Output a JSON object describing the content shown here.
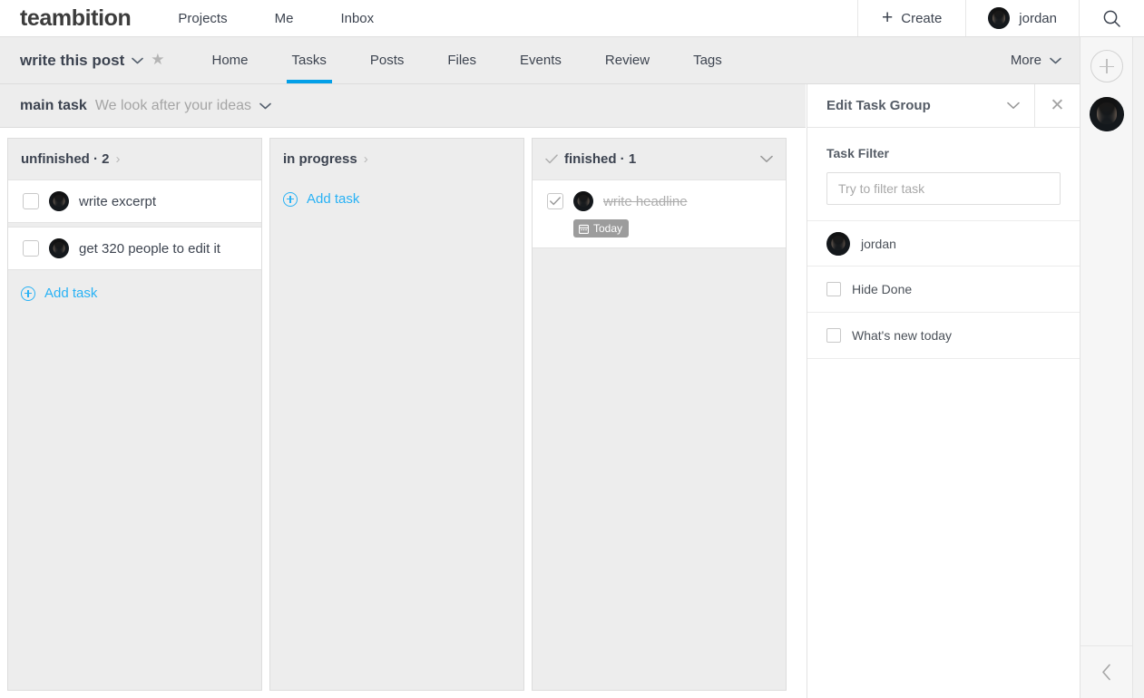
{
  "topbar": {
    "brand": "teambition",
    "nav": [
      {
        "label": "Projects"
      },
      {
        "label": "Me"
      },
      {
        "label": "Inbox"
      }
    ],
    "create_label": "Create",
    "create_icon": "plus-icon",
    "user_name": "jordan",
    "search_icon": "search-icon"
  },
  "projectbar": {
    "project_name": "write this post",
    "project_chevron_icon": "chevron-down-icon",
    "star_icon": "star-icon",
    "tabs": [
      {
        "label": "Home",
        "active": false
      },
      {
        "label": "Tasks",
        "active": true
      },
      {
        "label": "Posts",
        "active": false
      },
      {
        "label": "Files",
        "active": false
      },
      {
        "label": "Events",
        "active": false
      },
      {
        "label": "Review",
        "active": false
      },
      {
        "label": "Tags",
        "active": false
      }
    ],
    "more_label": "More",
    "more_icon": "chevron-down-icon",
    "accent_color": "#03a0e8"
  },
  "subheader": {
    "title": "main task",
    "description": "We look after your ideas",
    "chevron_icon": "chevron-down-icon"
  },
  "board": {
    "columns": [
      {
        "title": "unfinished · 2",
        "header_icon": "chevron-right-icon",
        "collapse_icon": null,
        "has_check": false,
        "tasks": [
          {
            "text": "write excerpt",
            "done": false,
            "badge": null
          },
          {
            "text": "get 320 people to edit it",
            "done": false,
            "badge": null
          }
        ],
        "add_label": "Add task",
        "add_icon": "plus-circle-icon",
        "show_add": true
      },
      {
        "title": "in progress",
        "header_icon": "chevron-right-icon",
        "collapse_icon": null,
        "has_check": false,
        "tasks": [],
        "add_label": "Add task",
        "add_icon": "plus-circle-icon",
        "show_add": true
      },
      {
        "title": "finished · 1",
        "header_icon": null,
        "collapse_icon": "chevron-down-icon",
        "has_check": true,
        "check_icon": "check-icon",
        "tasks": [
          {
            "text": "write headline",
            "done": true,
            "badge": "Today",
            "badge_icon": "calendar-icon"
          }
        ],
        "add_label": "Add task",
        "add_icon": "plus-circle-icon",
        "show_add": false
      }
    ]
  },
  "panel": {
    "title": "Edit Task Group",
    "collapse_icon": "chevron-down-icon",
    "close_icon": "close-icon",
    "filter_section_label": "Task Filter",
    "filter_placeholder": "Try to filter task",
    "filter_value": "",
    "rows": [
      {
        "label": "jordan",
        "type": "member"
      },
      {
        "label": "Hide Done",
        "type": "checkbox",
        "checked": false
      },
      {
        "label": "What's new today",
        "type": "checkbox",
        "checked": false
      }
    ]
  },
  "rail": {
    "add_icon": "plus-circle-icon",
    "avatar_name": "jordan",
    "collapse_icon": "chevron-left-icon"
  }
}
